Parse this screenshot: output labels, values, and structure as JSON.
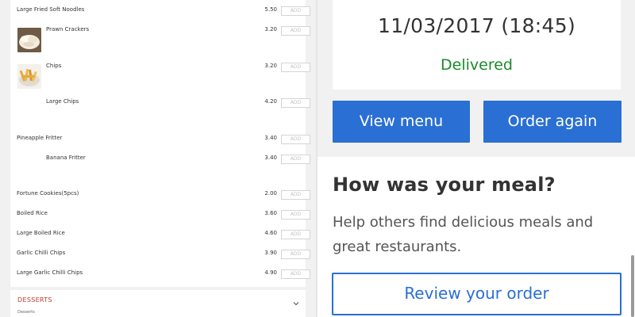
{
  "menu": {
    "add_label": "ADD",
    "items": [
      {
        "name": "Large Fried Soft Noodles",
        "price": "5.50"
      },
      {
        "name": "Prawn Crackers",
        "price": "3.20",
        "icon": "prawn-crackers-photo"
      },
      {
        "name": "Chips",
        "price": "3.20",
        "icon": "chips-photo"
      },
      {
        "name": "Large Chips",
        "price": "4.20"
      },
      {
        "name": "Pineapple Fritter",
        "price": "3.40"
      },
      {
        "name": "Banana Fritter",
        "price": "3.40"
      },
      {
        "name": "Fortune Cookies(5pcs)",
        "price": "2.00"
      },
      {
        "name": "Boiled Rice",
        "price": "3.60"
      },
      {
        "name": "Large Boiled Rice",
        "price": "4.60"
      },
      {
        "name": "Garlic Chilli Chips",
        "price": "3.90"
      },
      {
        "name": "Large Garlic Chilli Chips",
        "price": "4.90"
      }
    ],
    "section": {
      "title": "DESSERTS",
      "subtitle": "Desserts",
      "icon": "chevron-down-icon"
    }
  },
  "order": {
    "date": "11/03/2017 (18:45)",
    "status": "Delivered",
    "status_color": "#1a8a2a",
    "view_menu_label": "View menu",
    "order_again_label": "Order again"
  },
  "review": {
    "heading": "How was your meal?",
    "text": "Help others find delicious meals and great restaurants.",
    "button_label": "Review your order"
  },
  "colors": {
    "accent": "#2a6fd3",
    "section_title": "#c0392b"
  }
}
